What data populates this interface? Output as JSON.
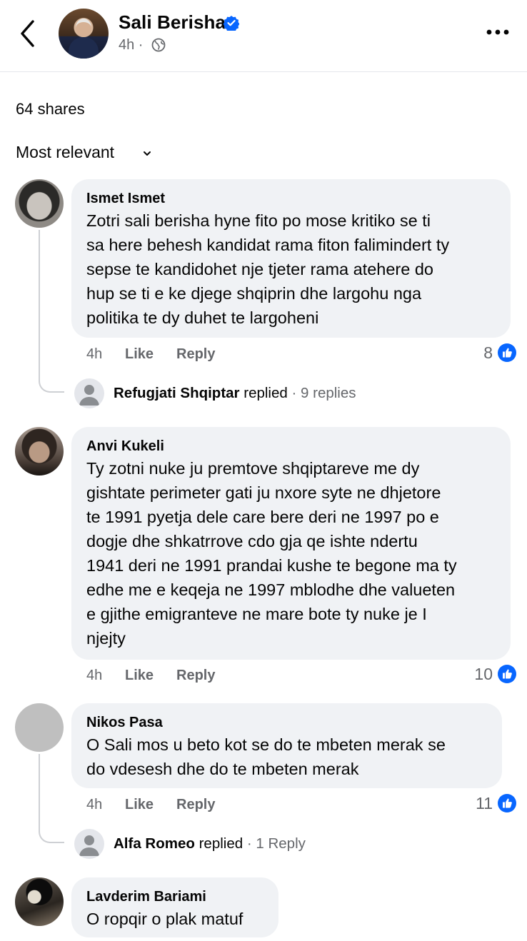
{
  "header": {
    "page_name": "Sali Berisha",
    "time": "4h ·",
    "icons": [
      "back-arrow-icon",
      "verified-badge-icon",
      "globe-icon",
      "more-options-icon"
    ]
  },
  "post": {
    "shares": "64 shares",
    "sort_label": "Most relevant"
  },
  "comments": [
    {
      "author": "Ismet Ismet",
      "text": "Zotri sali berisha hyne fito po mose kritiko se ti\nsa here behesh kandidat rama fiton falimindert ty\nsepse te kandidohet nje tjeter rama atehere do\nhup se ti e ke djege shqiprin dhe largohu nga\npolitika te dy duhet te largoheni",
      "time": "4h",
      "like": "Like",
      "reply": "Reply",
      "reactions": "8",
      "replies": {
        "name": "Refugjati Shqiptar",
        "verb": "replied",
        "count": "· 9 replies"
      }
    },
    {
      "author": "Anvi Kukeli",
      "text": "Ty zotni nuke ju premtove shqiptareve me dy\ngishtate perimeter gati ju nxore syte ne dhjetore\nte 1991 pyetja dele care bere deri ne 1997  po e\ndogje dhe shkatrrove cdo gja qe ishte ndertu\n1941 deri ne 1991 prandai kushe te begone ma ty\nedhe me e keqeja ne 1997 mblodhe dhe valueten\ne gjithe emigranteve ne mare bote ty nuke je I\nnjejty",
      "time": "4h",
      "like": "Like",
      "reply": "Reply",
      "reactions": "10"
    },
    {
      "author": "Nikos Pasa",
      "text": "O Sali mos u beto kot se do te mbeten merak se\ndo vdesesh dhe do te mbeten merak",
      "time": "4h",
      "like": "Like",
      "reply": "Reply",
      "reactions": "11",
      "replies": {
        "name": "Alfa Romeo",
        "verb": "replied",
        "count": "· 1 Reply"
      }
    },
    {
      "author": "Lavderim Bariami",
      "text": "O ropqir o plak matuf"
    }
  ],
  "colors": {
    "accent": "#0866ff",
    "bubble": "#f0f2f5",
    "secondary_text": "#65676b"
  }
}
